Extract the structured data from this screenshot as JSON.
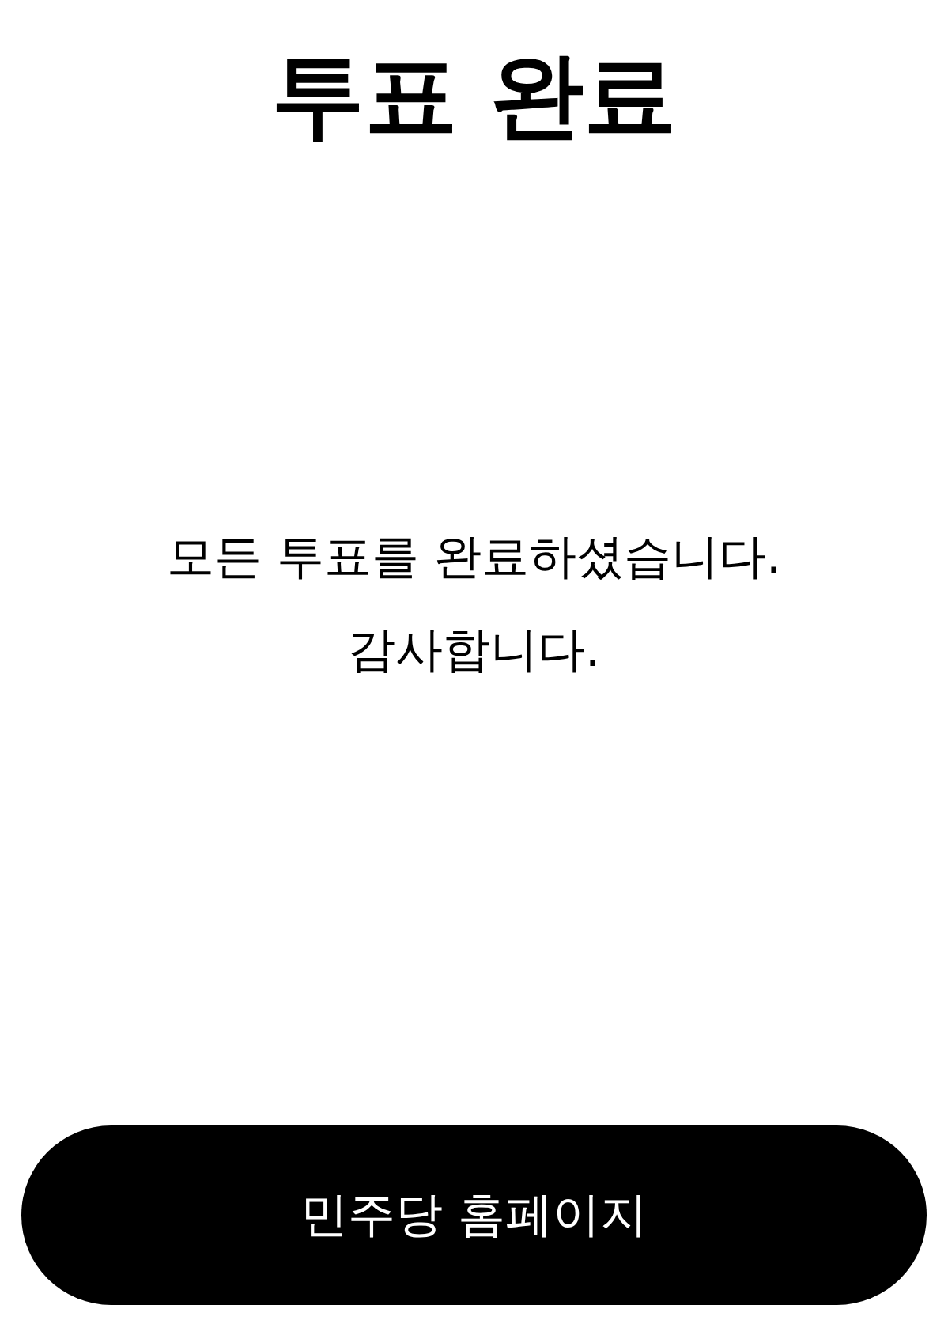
{
  "title": "투표 완료",
  "message": [
    "모든 투표를 완료하셨습니다.",
    "감사합니다."
  ],
  "button": {
    "label": "민주당 홈페이지"
  }
}
